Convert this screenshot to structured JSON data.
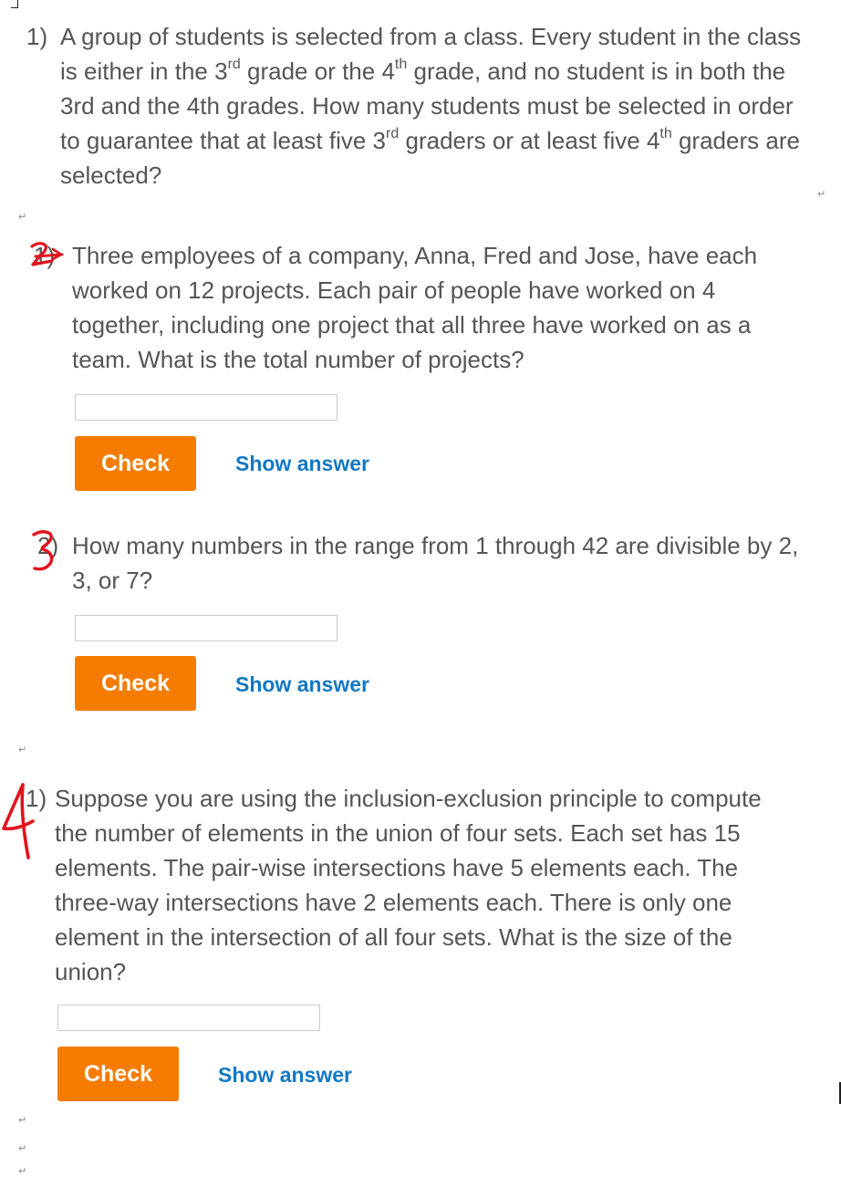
{
  "questions": [
    {
      "number": "1)",
      "text_html": "A group of students is selected from a class. Every student in the class is either in the 3<sup>rd</sup> grade or the 4<sup>th</sup> grade, and no student is in both the 3rd and the 4th grades. How many students must be selected in order to guarantee that at least five 3<sup>rd</sup> graders or at least five 4<sup>th</sup> graders are selected?"
    },
    {
      "number": "1)",
      "handwritten_number": "2",
      "text": "Three employees of a company, Anna, Fred and Jose, have each worked on 12 projects. Each pair of people have worked on 4 together, including one project that all three have worked on as a team. What is the total number of projects?",
      "input_value": "",
      "check_label": "Check",
      "show_answer_label": "Show answer"
    },
    {
      "number": "2)",
      "handwritten_number": "3",
      "text": "How many numbers in the range from 1 through 42 are divisible by 2, 3, or 7?",
      "input_value": "",
      "check_label": "Check",
      "show_answer_label": "Show answer"
    },
    {
      "number": "1)",
      "handwritten_number": "4",
      "text": "Suppose you are using the inclusion-exclusion principle to compute the number of elements in the union of four sets. Each set has 15 elements. The pair-wise intersections have 5 elements each. The three-way intersections have 2 elements each. There is only one element in the intersection of all four sets. What is the size of the union?",
      "input_value": "",
      "check_label": "Check",
      "show_answer_label": "Show answer"
    }
  ],
  "paragraph_mark": "↵",
  "colors": {
    "check_button": "#f57c00",
    "show_answer_link": "#1278c4",
    "body_text": "#555555",
    "handwriting": "#e0141e"
  }
}
